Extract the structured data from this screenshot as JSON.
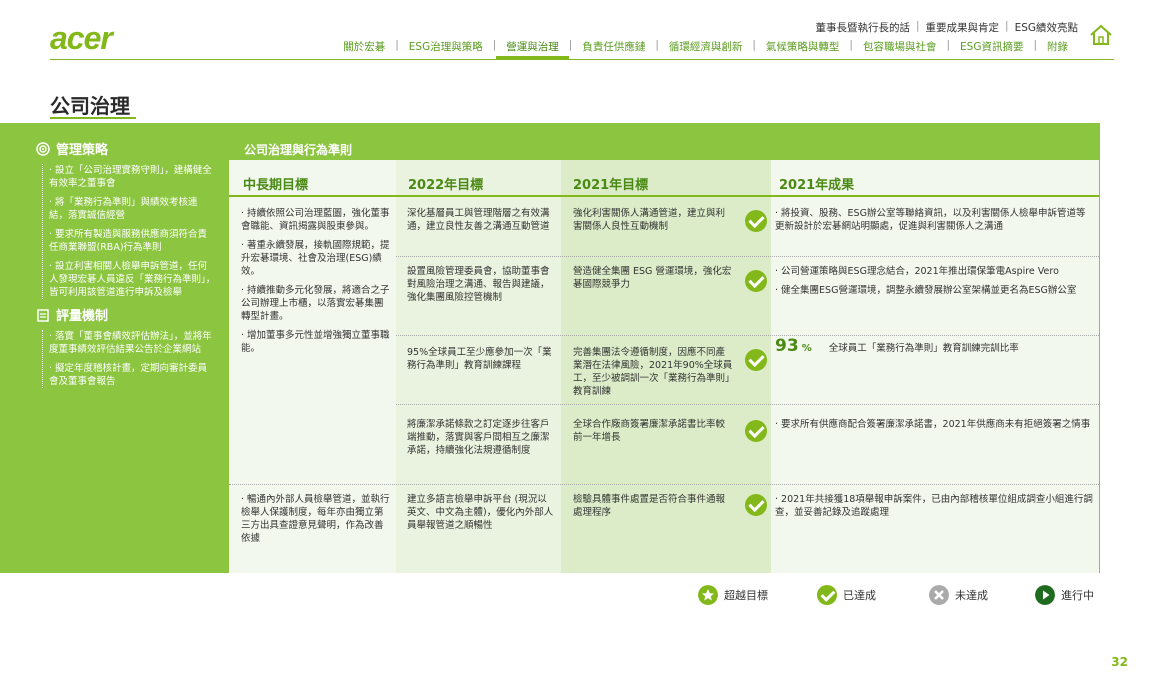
{
  "brand": {
    "logo": "acer",
    "accent": "#83b81a"
  },
  "top_links": [
    "董事長暨執行長的話",
    "重要成果與肯定",
    "ESG績效亮點"
  ],
  "nav": [
    {
      "label": "關於宏碁",
      "active": false
    },
    {
      "label": "ESG治理與策略",
      "active": false
    },
    {
      "label": "營運與治理",
      "active": true
    },
    {
      "label": "負責任供應鏈",
      "active": false
    },
    {
      "label": "循環經濟與創新",
      "active": false
    },
    {
      "label": "氣候策略與轉型",
      "active": false
    },
    {
      "label": "包容職場與社會",
      "active": false
    },
    {
      "label": "ESG資訊摘要",
      "active": false
    },
    {
      "label": "附錄",
      "active": false
    }
  ],
  "page_title": "公司治理",
  "sidebar": {
    "strategy_title": "管理策略",
    "strategy_items": [
      "設立「公司治理實務守則」，建構健全有效率之董事會",
      "將「業務行為準則」與績效考核連結，落實誠信經營",
      "要求所有製造與服務供應商須符合責任商業聯盟(RBA)行為準則",
      "設立利害相關人檢舉申訴管道，任何人發現宏碁人員違反「業務行為準則」，皆可利用該管道進行申訴及檢舉"
    ],
    "eval_title": "評量機制",
    "eval_items": [
      "落實「董事會績效評估辦法」，並將年度董事績效評估結果公告於企業網站",
      "擬定年度稽核計畫，定期向審計委員會及董事會報告"
    ]
  },
  "table": {
    "section_title": "公司治理與行為準則",
    "headers": [
      "中長期目標",
      "2022年目標",
      "2021年目標",
      "2021年成果"
    ],
    "long_term_1": [
      "持續依照公司治理藍圖，強化董事會職能、資訊揭露與股東參與。",
      "著重永續發展，接軌國際規範，提升宏碁環境、社會及治理(ESG)績效。",
      "持續推動多元化發展，將適合之子公司辦理上市櫃，以落實宏碁集團轉型計畫。",
      "增加董事多元性並增強獨立董事職能。"
    ],
    "long_term_2": [
      "暢通內外部人員檢舉管道，並執行檢舉人保護制度，每年亦由獨立第三方出具查證意見聲明，作為改善依據"
    ],
    "rows": [
      {
        "goal_2022": "深化基層員工與管理階層之有效溝通，建立良性友善之溝通互動管道",
        "goal_2021": "強化利害關係人溝通管道，建立與利害關係人良性互動機制",
        "result": [
          "將投資、股務、ESG辦公室等聯絡資訊，以及利害關係人檢舉申訴管道等更新設計於宏碁網站明顯處，促進與利害關係人之溝通"
        ]
      },
      {
        "goal_2022": "設置風險管理委員會，協助董事會對風險治理之溝通、報告與建議，強化集團風險控管機制",
        "goal_2021": "營造健全集團 ESG 營運環境，強化宏碁國際競爭力",
        "result": [
          "公司營運策略與ESG理念結合，2021年推出環保筆電Aspire Vero",
          "健全集團ESG營運環境，調整永續發展辦公室架構並更名為ESG辦公室"
        ]
      },
      {
        "goal_2022": "95%全球員工至少應參加一次「業務行為準則」教育訓練課程",
        "goal_2021": "完善集團法令遵循制度，因應不同產業潛在法律風險，2021年90%全球員工，至少被調訓一次「業務行為準則」教育訓練",
        "result_value": "93",
        "result_unit": "%",
        "result_text": "全球員工「業務行為準則」教育訓練完訓比率"
      },
      {
        "goal_2022": "將廉潔承諾條款之訂定逐步往客戶端推動，落實與客戶間相互之廉潔承諾，持續強化法規遵循制度",
        "goal_2021": "全球合作廠商簽署廉潔承諾書比率較前一年增長",
        "result": [
          "要求所有供應商配合簽署廉潔承諾書，2021年供應商未有拒絕簽署之情事"
        ]
      },
      {
        "goal_2022": "建立多語言檢舉申訴平台 (現況以英文、中文為主體)，優化內外部人員舉報管道之順暢性",
        "goal_2021": "檢驗具體事件處置是否符合事件通報處理程序",
        "result": [
          "2021年共接獲18項舉報申訴案件，已由內部稽核單位組成調查小組進行調查，並妥善記錄及追蹤處理"
        ]
      }
    ]
  },
  "legend": [
    "超越目標",
    "已達成",
    "未達成",
    "進行中"
  ],
  "page_number": "32"
}
